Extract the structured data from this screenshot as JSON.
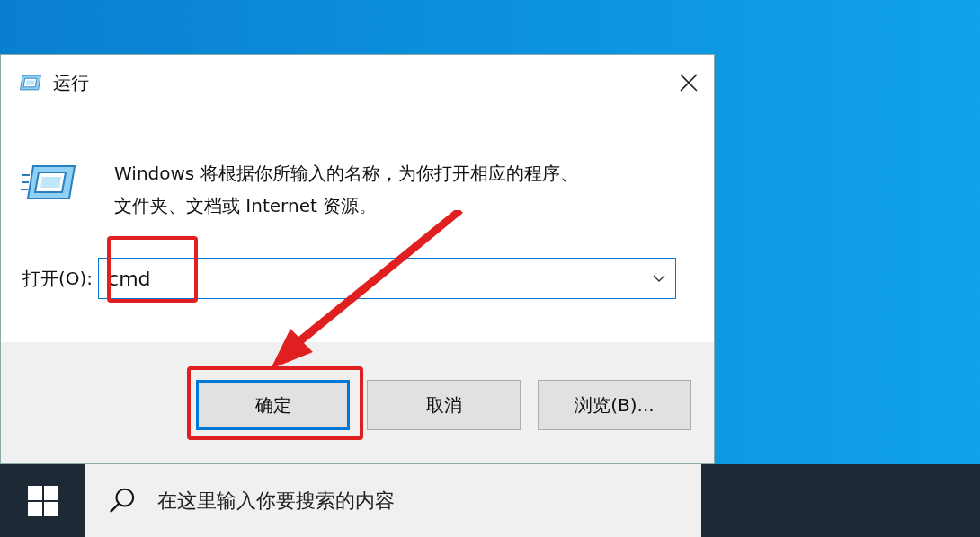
{
  "window": {
    "title": "运行"
  },
  "description": "Windows 将根据你所输入的名称，为你打开相应的程序、文件夹、文档或 Internet 资源。",
  "open_field": {
    "label": "打开(O):",
    "value": "cmd"
  },
  "buttons": [
    {
      "label": "确定",
      "default": true
    },
    {
      "label": "取消",
      "default": false
    },
    {
      "label": "浏览(B)...",
      "default": false
    }
  ],
  "taskbar": {
    "search": {
      "placeholder": "在这里输入你要搜索的内容"
    }
  }
}
